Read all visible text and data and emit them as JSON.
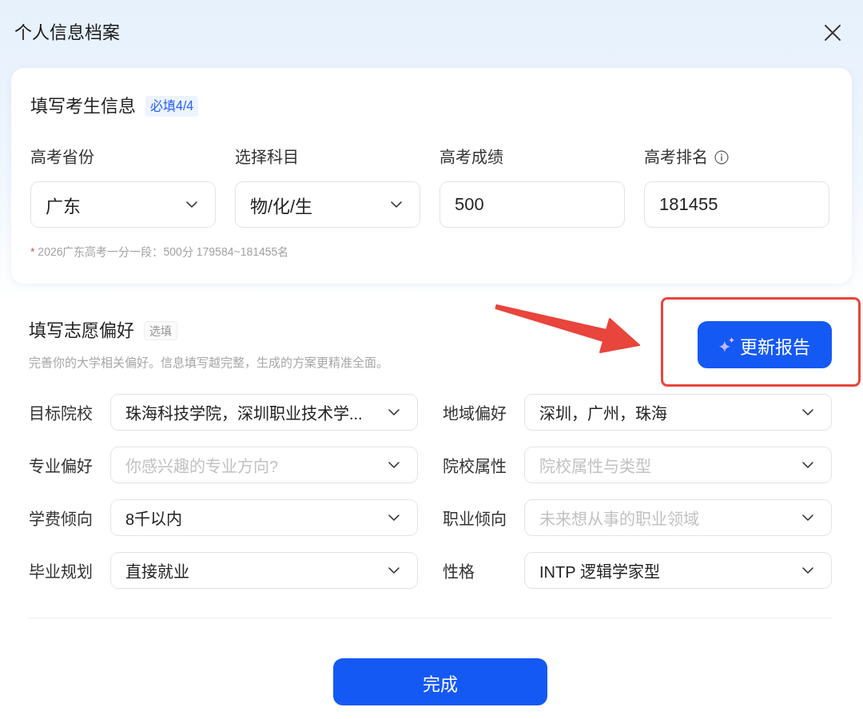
{
  "dialog": {
    "title": "个人信息档案"
  },
  "candidate_info": {
    "heading": "填写考生信息",
    "badge": "必填4/4",
    "fields": [
      {
        "kind": "select",
        "label": "高考省份",
        "value": "广东",
        "info": false
      },
      {
        "kind": "select",
        "label": "选择科目",
        "value": "物/化/生",
        "info": false
      },
      {
        "kind": "input",
        "label": "高考成绩",
        "value": "500",
        "info": false
      },
      {
        "kind": "input",
        "label": "高考排名",
        "value": "181455",
        "info": true
      }
    ],
    "note": {
      "marker": "*",
      "text": "2026广东高考一分一段：500分 179584~181455名"
    }
  },
  "preferences": {
    "heading": "填写志愿偏好",
    "badge": "选填",
    "description": "完善你的大学相关偏好。信息填写越完整，生成的方案更精准全面。",
    "update_button": "更新报告",
    "fields": [
      {
        "label": "目标院校",
        "value": "珠海科技学院，深圳职业技术学..."
      },
      {
        "label": "地域偏好",
        "value": "深圳，广州，珠海"
      },
      {
        "label": "专业偏好",
        "placeholder": "你感兴趣的专业方向?"
      },
      {
        "label": "院校属性",
        "placeholder": "院校属性与类型"
      },
      {
        "label": "学费倾向",
        "value": "8千以内"
      },
      {
        "label": "职业倾向",
        "placeholder": "未来想从事的职业领域"
      },
      {
        "label": "毕业规划",
        "value": "直接就业"
      },
      {
        "label": "性格",
        "value": "INTP 逻辑学家型"
      }
    ]
  },
  "done_button": "完成"
}
